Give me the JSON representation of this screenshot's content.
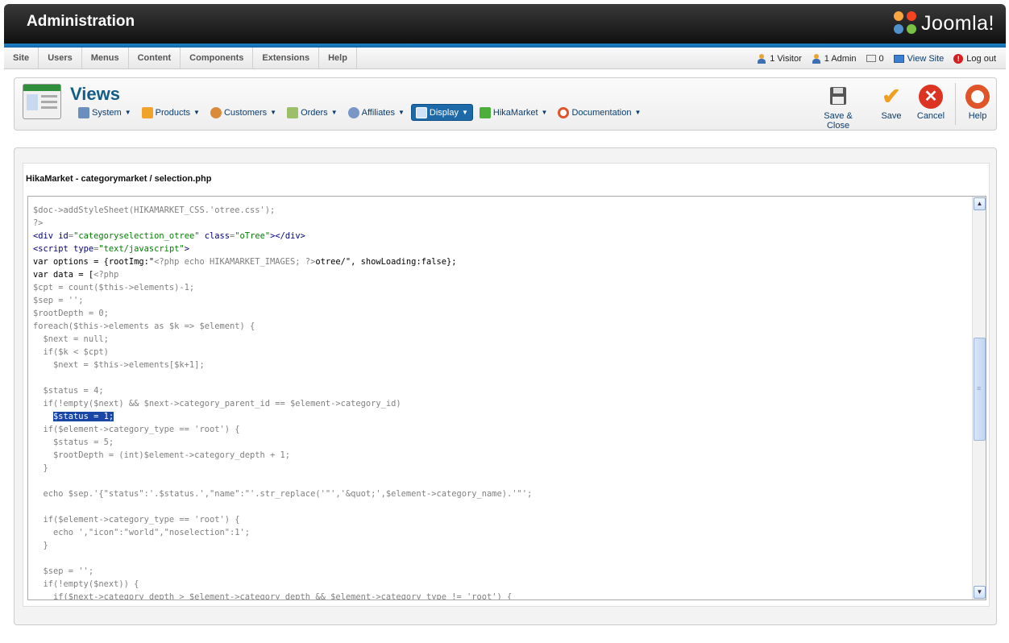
{
  "header": {
    "title": "Administration",
    "logo_text": "Joomla!"
  },
  "menubar": {
    "items": [
      "Site",
      "Users",
      "Menus",
      "Content",
      "Components",
      "Extensions",
      "Help"
    ]
  },
  "status": {
    "visitors": "1 Visitor",
    "admins": "1 Admin",
    "messages": "0",
    "view_site": "View Site",
    "logout": "Log out"
  },
  "toolbar": {
    "page_title": "Views",
    "nav": [
      "System",
      "Products",
      "Customers",
      "Orders",
      "Affiliates",
      "Display",
      "HikaMarket",
      "Documentation"
    ],
    "active_nav": "Display",
    "save_close_label": "Save & Close",
    "save_label": "Save",
    "cancel_label": "Cancel",
    "help_label": "Help"
  },
  "editor": {
    "file_title": "HikaMarket - categorymarket / selection.php",
    "lines": [
      "$doc->addStyleSheet(HIKAMARKET_CSS.'otree.css');",
      "?>",
      "<div id=\"categoryselection_otree\" class=\"oTree\"></div>",
      "<script type=\"text/javascript\">",
      "var options = {rootImg:\"<?php echo HIKAMARKET_IMAGES; ?>otree/\", showLoading:false};",
      "var data = [<?php",
      "$cpt = count($this->elements)-1;",
      "$sep = '';",
      "$rootDepth = 0;",
      "foreach($this->elements as $k => $element) {",
      "  $next = null;",
      "  if($k < $cpt)",
      "    $next = $this->elements[$k+1];",
      "",
      "  $status = 4;",
      "  if(!empty($next) && $next->category_parent_id == $element->category_id)",
      "    $status = 1;",
      "  if($element->category_type == 'root') {",
      "    $status = 5;",
      "    $rootDepth = (int)$element->category_depth + 1;",
      "  }",
      "",
      "  echo $sep.'{\"status\":'.$status.',\"name\":\"'.str_replace('\"','&quot;',$element->category_name).'\"';",
      "",
      "  if($element->category_type == 'root') {",
      "    echo ',\"icon\":\"world\",\"noselection\":1';",
      "  }",
      "",
      "  $sep = '';",
      "  if(!empty($next)) {",
      "    if($next->category_depth > $element->category_depth && $element->category_type != 'root') {"
    ]
  },
  "colors": {
    "header_dark": "#1a1a1a",
    "brand_blue": "#1d7fc4",
    "title_blue": "#145e86",
    "selection": "#1a46a8"
  }
}
